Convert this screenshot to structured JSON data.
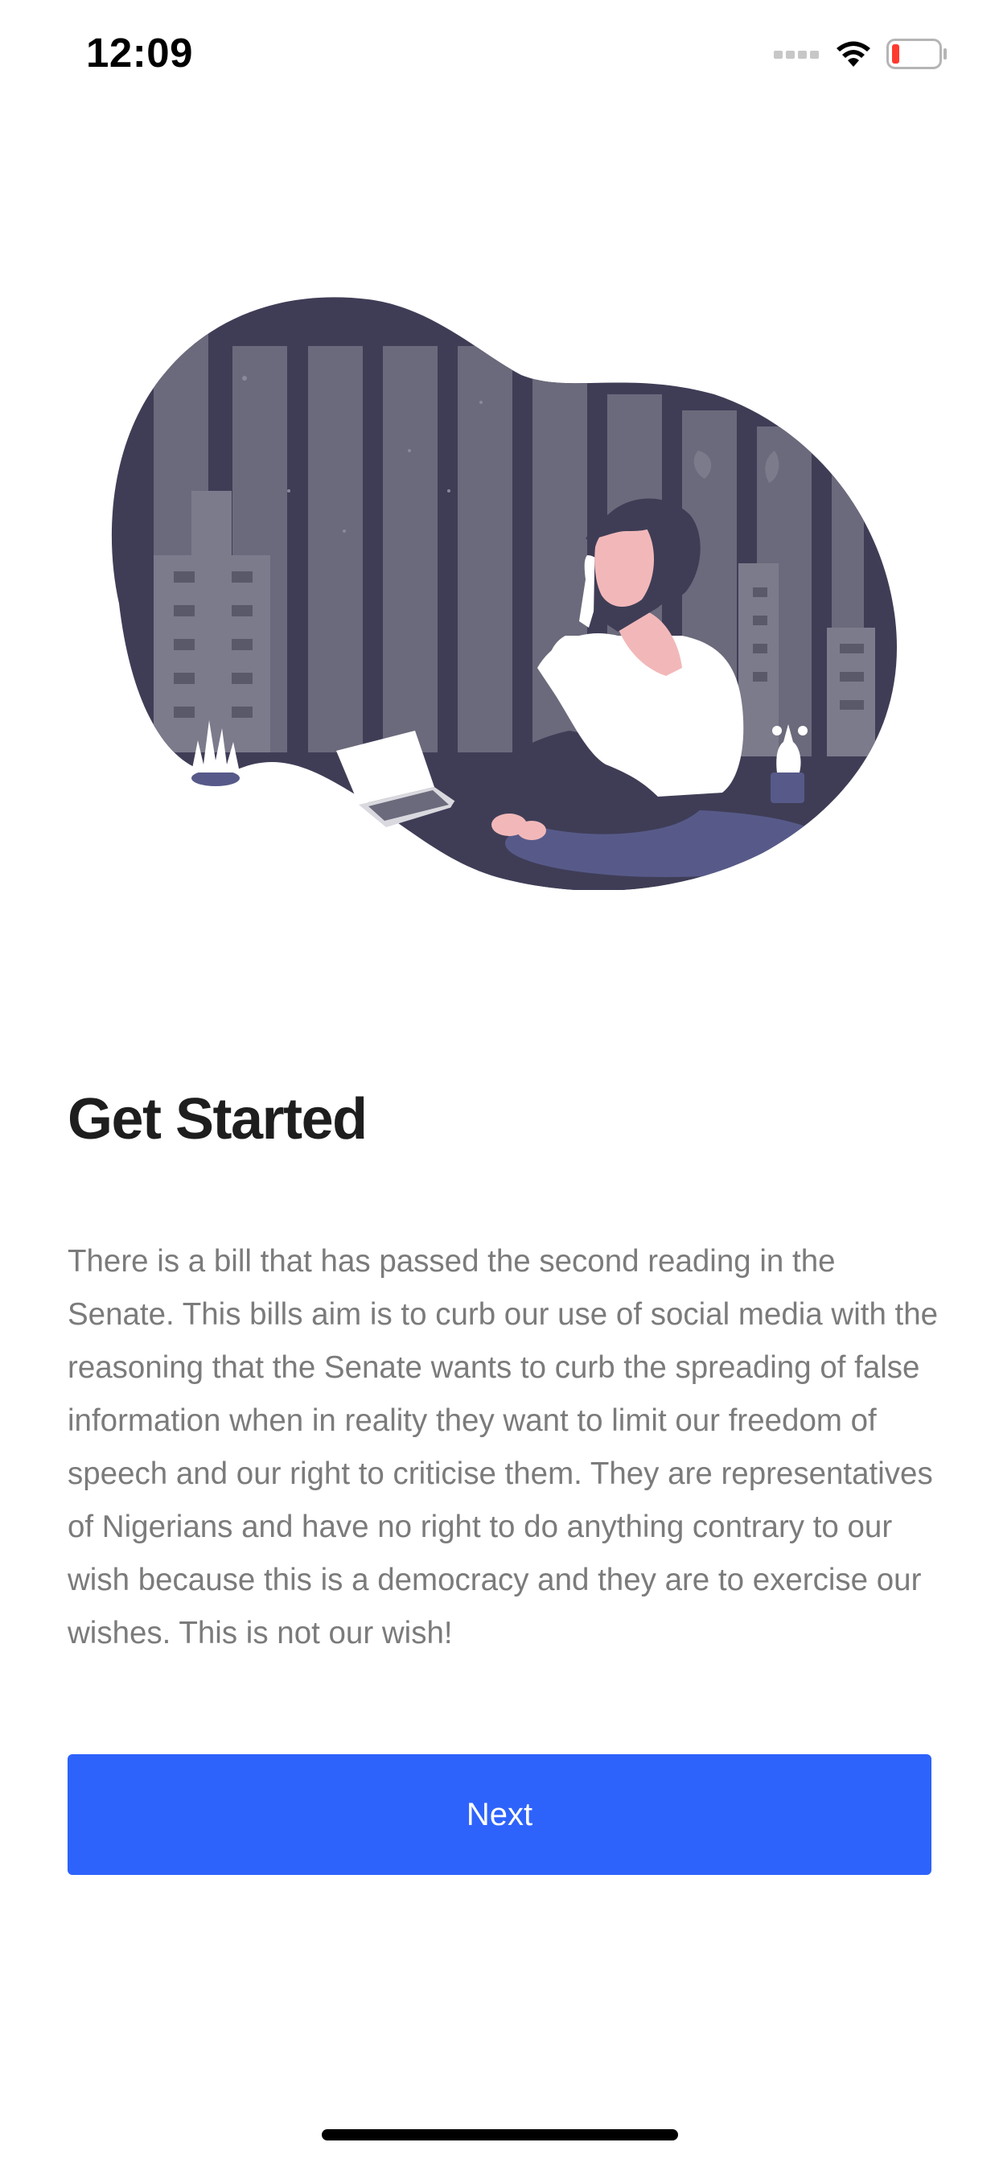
{
  "status_bar": {
    "time": "12:09"
  },
  "onboarding": {
    "title": "Get Started",
    "description": "There is a bill that has passed the second reading in the Senate. This bills aim is to curb our use of social media with the reasoning that the Senate wants to curb the spreading of false information when in reality they want to limit our freedom of speech and our right to criticise them. They are representatives of Nigerians and have no right to do anything contrary to our wish because this is a democracy and they are to exercise our wishes. This is not our wish!",
    "next_label": "Next"
  },
  "icons": {
    "signal": "cellular-signal-icon",
    "wifi": "wifi-icon",
    "battery": "battery-low-icon"
  },
  "colors": {
    "accent": "#2e63fb",
    "battery_low": "#ff3b30",
    "illustration_dark": "#3f3d56"
  }
}
